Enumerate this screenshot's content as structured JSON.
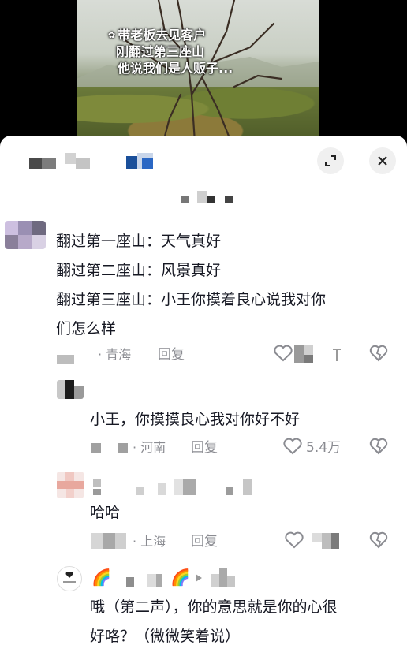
{
  "video": {
    "caption_lines": [
      "带老板去见客户",
      "刚翻过第三座山",
      "他说我们是人贩子..."
    ]
  },
  "panel": {
    "expand_icon": "expand-icon",
    "close_icon": "close-icon"
  },
  "comments": [
    {
      "lines": [
        "翻过第一座山：天气真好",
        "翻过第二座山：风景真好",
        "翻过第三座山：小王你摸着良心说我对你",
        "们怎么样"
      ],
      "location": "· 青海",
      "reply_label": "回复"
    },
    {
      "lines": [
        "小王，你摸摸良心我对你好不好"
      ],
      "location": "· 河南",
      "reply_label": "回复",
      "like_count": "5.4万"
    },
    {
      "lines": [
        "哈哈"
      ],
      "location": "· 上海",
      "reply_label": "回复"
    },
    {
      "lines": [
        "哦（第二声），你的意思就是你的心很",
        "好咯？（微微笑着说）"
      ]
    }
  ]
}
